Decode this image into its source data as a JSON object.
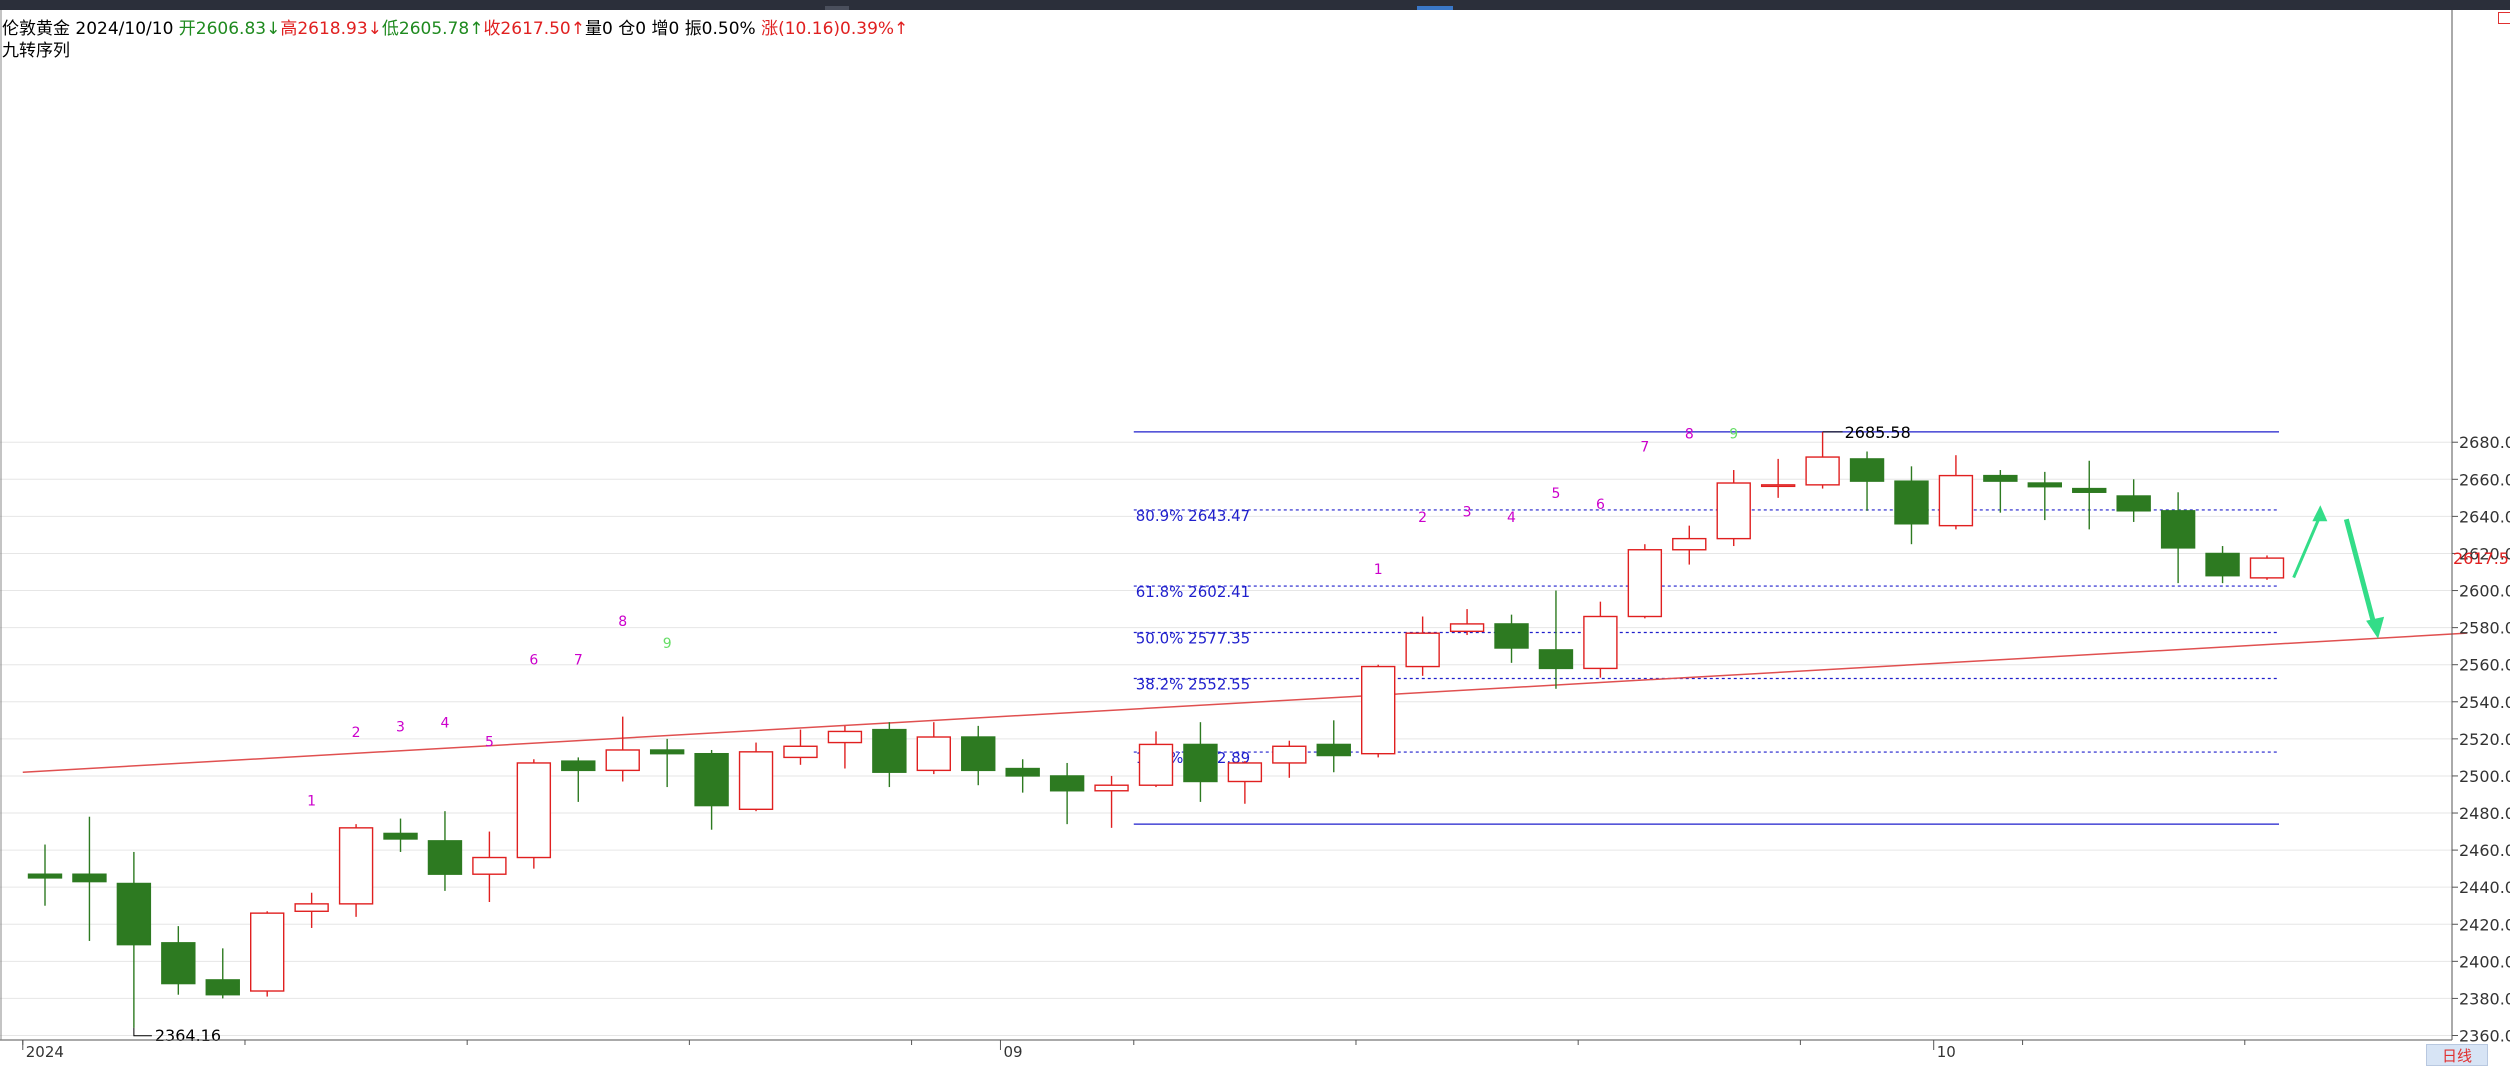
{
  "header": {
    "symbol": "伦敦黄金",
    "date": "2024/10/10",
    "open_label": "开2606.83↓",
    "high_label": "高2618.93↓",
    "low_label": "低2605.78↑",
    "close_label": "收2617.50↑",
    "volume_label": "量0",
    "oi_label": "仓0",
    "increase_label": "增0",
    "amplitude_label": "振0.50%",
    "change_label": "涨(10.16)0.39%↑"
  },
  "indicator": {
    "name": "九转序列"
  },
  "timeframe": {
    "label": "日线"
  },
  "colors": {
    "up": "#e02020",
    "down": "#2d7a21",
    "grid": "#e6e6e6",
    "fib": "#1f1fcc",
    "trendline": "#e05050",
    "arrow": "#33dd88",
    "td_up": "#cc00cc",
    "td_nine": "#66dd66"
  },
  "chart_data": {
    "type": "candlestick",
    "ylim": [
      2360,
      2695
    ],
    "y_ticks": [
      "2360.00",
      "2380.00",
      "2400.00",
      "2420.00",
      "2440.00",
      "2460.00",
      "2480.00",
      "2500.00",
      "2520.00",
      "2540.00",
      "2560.00",
      "2580.00",
      "2600.00",
      "2620.00",
      "2640.00",
      "2660.00",
      "2680.00"
    ],
    "x_labels": [
      {
        "index": 0,
        "text": "2024"
      },
      {
        "index": 22,
        "text": "09"
      },
      {
        "index": 43,
        "text": "10"
      }
    ],
    "last_price": "2617.50",
    "candles": [
      {
        "o": 2447,
        "h": 2463,
        "l": 2430,
        "c": 2445
      },
      {
        "o": 2447,
        "h": 2478,
        "l": 2411,
        "c": 2443
      },
      {
        "o": 2442,
        "h": 2459,
        "l": 2364.16,
        "c": 2409
      },
      {
        "o": 2410,
        "h": 2419,
        "l": 2382,
        "c": 2388
      },
      {
        "o": 2390,
        "h": 2407,
        "l": 2380,
        "c": 2382
      },
      {
        "o": 2384,
        "h": 2427,
        "l": 2381,
        "c": 2426
      },
      {
        "o": 2427,
        "h": 2437,
        "l": 2418,
        "c": 2431
      },
      {
        "o": 2431,
        "h": 2474,
        "l": 2424,
        "c": 2472
      },
      {
        "o": 2469,
        "h": 2477,
        "l": 2459,
        "c": 2466
      },
      {
        "o": 2465,
        "h": 2481,
        "l": 2438,
        "c": 2447
      },
      {
        "o": 2447,
        "h": 2470,
        "l": 2432,
        "c": 2456
      },
      {
        "o": 2456,
        "h": 2509,
        "l": 2450,
        "c": 2507
      },
      {
        "o": 2508,
        "h": 2510,
        "l": 2486,
        "c": 2503
      },
      {
        "o": 2503,
        "h": 2532,
        "l": 2497,
        "c": 2514
      },
      {
        "o": 2514,
        "h": 2520,
        "l": 2494,
        "c": 2512
      },
      {
        "o": 2512,
        "h": 2514,
        "l": 2471,
        "c": 2484
      },
      {
        "o": 2482,
        "h": 2518,
        "l": 2481,
        "c": 2513
      },
      {
        "o": 2510,
        "h": 2525,
        "l": 2506,
        "c": 2516
      },
      {
        "o": 2518,
        "h": 2527,
        "l": 2504,
        "c": 2524
      },
      {
        "o": 2525,
        "h": 2529,
        "l": 2494,
        "c": 2502
      },
      {
        "o": 2503,
        "h": 2529,
        "l": 2501,
        "c": 2521
      },
      {
        "o": 2521,
        "h": 2527,
        "l": 2495,
        "c": 2503
      },
      {
        "o": 2504,
        "h": 2509,
        "l": 2491,
        "c": 2500
      },
      {
        "o": 2500,
        "h": 2507,
        "l": 2474,
        "c": 2492
      },
      {
        "o": 2492,
        "h": 2500,
        "l": 2472,
        "c": 2495
      },
      {
        "o": 2495,
        "h": 2524,
        "l": 2494,
        "c": 2517
      },
      {
        "o": 2517,
        "h": 2529,
        "l": 2486,
        "c": 2497
      },
      {
        "o": 2497,
        "h": 2508,
        "l": 2485,
        "c": 2507
      },
      {
        "o": 2507,
        "h": 2519,
        "l": 2499,
        "c": 2516
      },
      {
        "o": 2517,
        "h": 2530,
        "l": 2502,
        "c": 2511
      },
      {
        "o": 2512,
        "h": 2560,
        "l": 2510,
        "c": 2559
      },
      {
        "o": 2559,
        "h": 2586,
        "l": 2554,
        "c": 2577
      },
      {
        "o": 2578,
        "h": 2590,
        "l": 2576,
        "c": 2582
      },
      {
        "o": 2582,
        "h": 2587,
        "l": 2561,
        "c": 2569
      },
      {
        "o": 2568,
        "h": 2600,
        "l": 2547,
        "c": 2558
      },
      {
        "o": 2558,
        "h": 2594,
        "l": 2553,
        "c": 2586
      },
      {
        "o": 2586,
        "h": 2625,
        "l": 2585,
        "c": 2622
      },
      {
        "o": 2622,
        "h": 2635,
        "l": 2614,
        "c": 2628
      },
      {
        "o": 2628,
        "h": 2665,
        "l": 2624,
        "c": 2658
      },
      {
        "o": 2657,
        "h": 2671,
        "l": 2650,
        "c": 2657
      },
      {
        "o": 2657,
        "h": 2685.58,
        "l": 2655,
        "c": 2672
      },
      {
        "o": 2671,
        "h": 2675,
        "l": 2643,
        "c": 2659
      },
      {
        "o": 2659,
        "h": 2667,
        "l": 2625,
        "c": 2636
      },
      {
        "o": 2635,
        "h": 2673,
        "l": 2633,
        "c": 2662
      },
      {
        "o": 2662,
        "h": 2665,
        "l": 2642,
        "c": 2659
      },
      {
        "o": 2658,
        "h": 2664,
        "l": 2638,
        "c": 2656
      },
      {
        "o": 2655,
        "h": 2670,
        "l": 2633,
        "c": 2653
      },
      {
        "o": 2651,
        "h": 2660,
        "l": 2637,
        "c": 2643
      },
      {
        "o": 2643,
        "h": 2653,
        "l": 2604,
        "c": 2623
      },
      {
        "o": 2620,
        "h": 2624,
        "l": 2604,
        "c": 2608
      },
      {
        "o": 2606.83,
        "h": 2618.93,
        "l": 2605.78,
        "c": 2617.5
      }
    ],
    "marks": [
      {
        "index": 2,
        "price": 2364.16,
        "text": "2364.16",
        "pos": "low"
      },
      {
        "index": 40,
        "price": 2685.58,
        "text": "2685.58",
        "pos": "high"
      }
    ],
    "td_sequence": [
      {
        "index": 6,
        "text": "1",
        "price": 2484
      },
      {
        "index": 7,
        "text": "2",
        "price": 2521
      },
      {
        "index": 8,
        "text": "3",
        "price": 2524
      },
      {
        "index": 9,
        "text": "4",
        "price": 2526
      },
      {
        "index": 10,
        "text": "5",
        "price": 2516
      },
      {
        "index": 11,
        "text": "6",
        "price": 2560
      },
      {
        "index": 12,
        "text": "7",
        "price": 2560
      },
      {
        "index": 13,
        "text": "8",
        "price": 2581
      },
      {
        "index": 14,
        "text": "9",
        "price": 2569
      },
      {
        "index": 30,
        "text": "1",
        "price": 2609
      },
      {
        "index": 31,
        "text": "2",
        "price": 2637
      },
      {
        "index": 32,
        "text": "3",
        "price": 2640
      },
      {
        "index": 33,
        "text": "4",
        "price": 2637
      },
      {
        "index": 34,
        "text": "5",
        "price": 2650
      },
      {
        "index": 35,
        "text": "6",
        "price": 2644
      },
      {
        "index": 36,
        "text": "7",
        "price": 2675
      },
      {
        "index": 37,
        "text": "8",
        "price": 2682
      },
      {
        "index": 38,
        "text": "9",
        "price": 2682
      }
    ],
    "fib": {
      "low": 2474,
      "high": 2685.58,
      "start_index": 25,
      "end_index": 50,
      "levels": [
        {
          "price": 2643.47,
          "label": "80.9% 2643.47"
        },
        {
          "price": 2602.41,
          "label": "61.8% 2602.41"
        },
        {
          "price": 2577.35,
          "label": "50.0% 2577.35"
        },
        {
          "price": 2552.55,
          "label": "38.2% 2552.55"
        },
        {
          "price": 2512.89,
          "label": "19.1% 2512.89"
        }
      ]
    },
    "trendline": {
      "from": {
        "index": -0.5,
        "price": 2502
      },
      "to": {
        "index": 54.5,
        "price": 2577
      }
    },
    "arrow": {
      "start": {
        "index": 50.6,
        "price": 2607
      },
      "peak": {
        "index": 51.2,
        "price": 2646
      },
      "end": {
        "index": 52.5,
        "price": 2574
      }
    }
  }
}
